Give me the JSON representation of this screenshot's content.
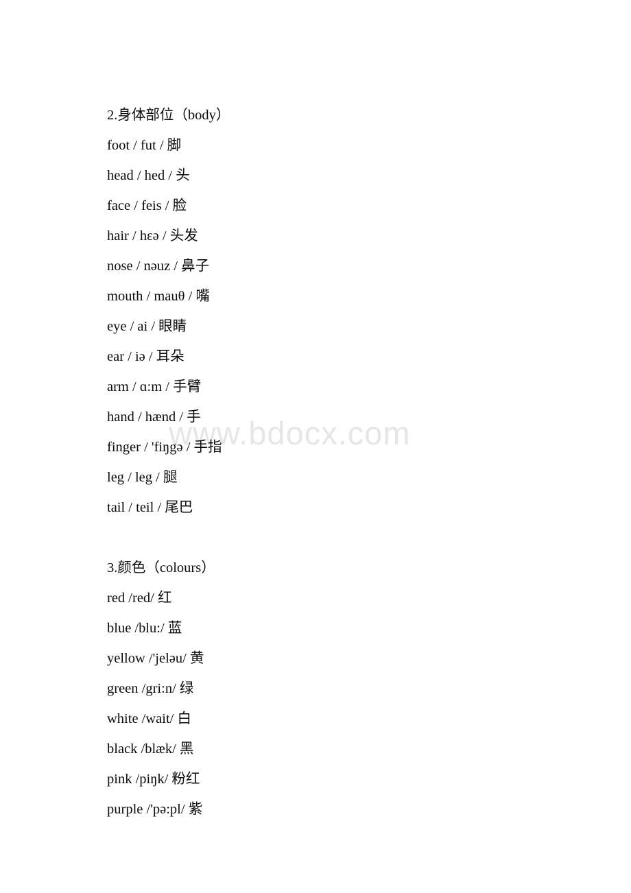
{
  "document": {
    "watermark": "www.bdocx.com",
    "sections": [
      {
        "heading": "2.身体部位（body）",
        "entries": [
          "foot / fut / 脚",
          "head / hed / 头",
          "face / feis / 脸",
          "hair / hɛə / 头发",
          "nose / nəuz / 鼻子",
          "mouth / mauθ / 嘴",
          "eye / ai / 眼睛",
          "ear / iə / 耳朵",
          "arm / ɑ:m / 手臂",
          "hand / hænd / 手",
          "finger / 'fiŋgə / 手指",
          "leg / leg / 腿",
          "tail / teil / 尾巴"
        ]
      },
      {
        "heading": "3.颜色（colours）",
        "entries": [
          "red /red/ 红",
          "blue /blu:/ 蓝",
          "yellow /'jeləu/ 黄",
          "green /gri:n/ 绿",
          "white /wait/ 白",
          "black /blæk/ 黑",
          "pink /piŋk/ 粉红",
          "purple /'pə:pl/ 紫"
        ]
      }
    ]
  }
}
